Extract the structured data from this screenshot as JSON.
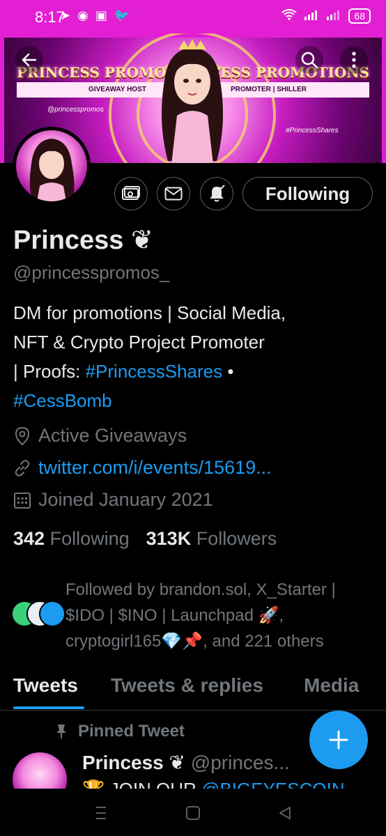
{
  "status_bar": {
    "time": "8:17",
    "battery": "68"
  },
  "banner": {
    "brand_left": "PRINCESS PROMOTIONS",
    "brand_left_sub": "GIVEAWAY HOST",
    "brand_right": "PRINCESS PROMOTIONS",
    "brand_right_sub": "PROMOTER | SHILLER",
    "tag_left": "@princesspromos",
    "tag_right": "#PrincessShares"
  },
  "profile": {
    "name": "Princess",
    "name_emoji": "❦",
    "handle": "@princesspromos_",
    "following_button": "Following",
    "bio_line1": "DM for promotions | Social Media,",
    "bio_line2": "NFT & Crypto Project Promoter",
    "bio_line3_prefix": "| Proofs: ",
    "bio_hashtag1": "#PrincessShares",
    "bio_separator": " •",
    "bio_hashtag2": "#CessBomb",
    "location": "Active Giveaways",
    "url": "twitter.com/i/events/15619...",
    "joined": "Joined January 2021",
    "following_count": "342",
    "following_label": "Following",
    "followers_count": "313K",
    "followers_label": "Followers",
    "followed_by_line1": "Followed by brandon.sol, X_Starter |",
    "followed_by_line2": "$IDO | $INO | Launchpad 🚀,",
    "followed_by_line3": "cryptogirl165💎📌, and 221 others"
  },
  "tabs": [
    {
      "label": "Tweets"
    },
    {
      "label": "Tweets & replies"
    },
    {
      "label": "Media"
    }
  ],
  "pinned": {
    "label": "Pinned Tweet",
    "author": "Princess",
    "author_emoji": "❦",
    "handle": "@princes...",
    "text_prefix": "🏆 JOIN OUR ",
    "text_link": "@BIGEYESCOIN"
  },
  "colors": {
    "accent": "#1d9bf0",
    "banner": "#e21fd2",
    "muted": "#71767b"
  }
}
